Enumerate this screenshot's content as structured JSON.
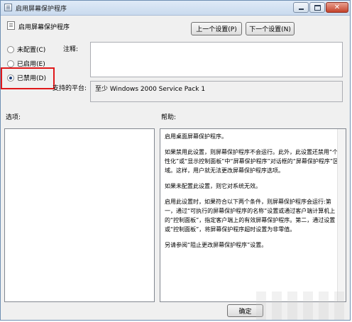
{
  "window": {
    "title": "启用屏幕保护程序",
    "controls": {
      "minimize": "minimize",
      "maximize": "maximize",
      "close": "✕"
    }
  },
  "header": {
    "policy_name": "启用屏幕保护程序",
    "prev_button": "上一个设置(P)",
    "next_button": "下一个设置(N)"
  },
  "state_options": [
    {
      "label": "未配置(C)",
      "checked": false
    },
    {
      "label": "已启用(E)",
      "checked": false
    },
    {
      "label": "已禁用(D)",
      "checked": true
    }
  ],
  "comment": {
    "label": "注释:",
    "value": ""
  },
  "platform": {
    "label": "支持的平台:",
    "value": "至少 Windows 2000 Service Pack 1"
  },
  "options": {
    "label": "选项:"
  },
  "help": {
    "label": "帮助:",
    "paragraphs": [
      "启用桌面屏幕保护程序。",
      "如果禁用此设置，则屏幕保护程序不会运行。此外，此设置还禁用“个性化”或“显示控制面板”中“屏幕保护程序”对话框的“屏幕保护程序”区域。这样，用户就无法更改屏幕保护程序选项。",
      "如果未配置此设置，则它对系统无效。",
      "启用此设置时，如果符合以下两个条件，则屏幕保护程序会运行:第一，通过“可执行的屏幕保护程序的名称”设置或通过客户端计算机上的“控制面板”，指定客户端上的有效屏幕保护程序。第二，通过设置或“控制面板”，将屏幕保护程序超时设置为非零值。",
      "另请参阅“阻止更改屏幕保护程序”设置。"
    ]
  },
  "footer": {
    "ok_button": "确定"
  },
  "colors": {
    "highlight_box": "#e0181a",
    "titlebar": "#c9daee"
  }
}
